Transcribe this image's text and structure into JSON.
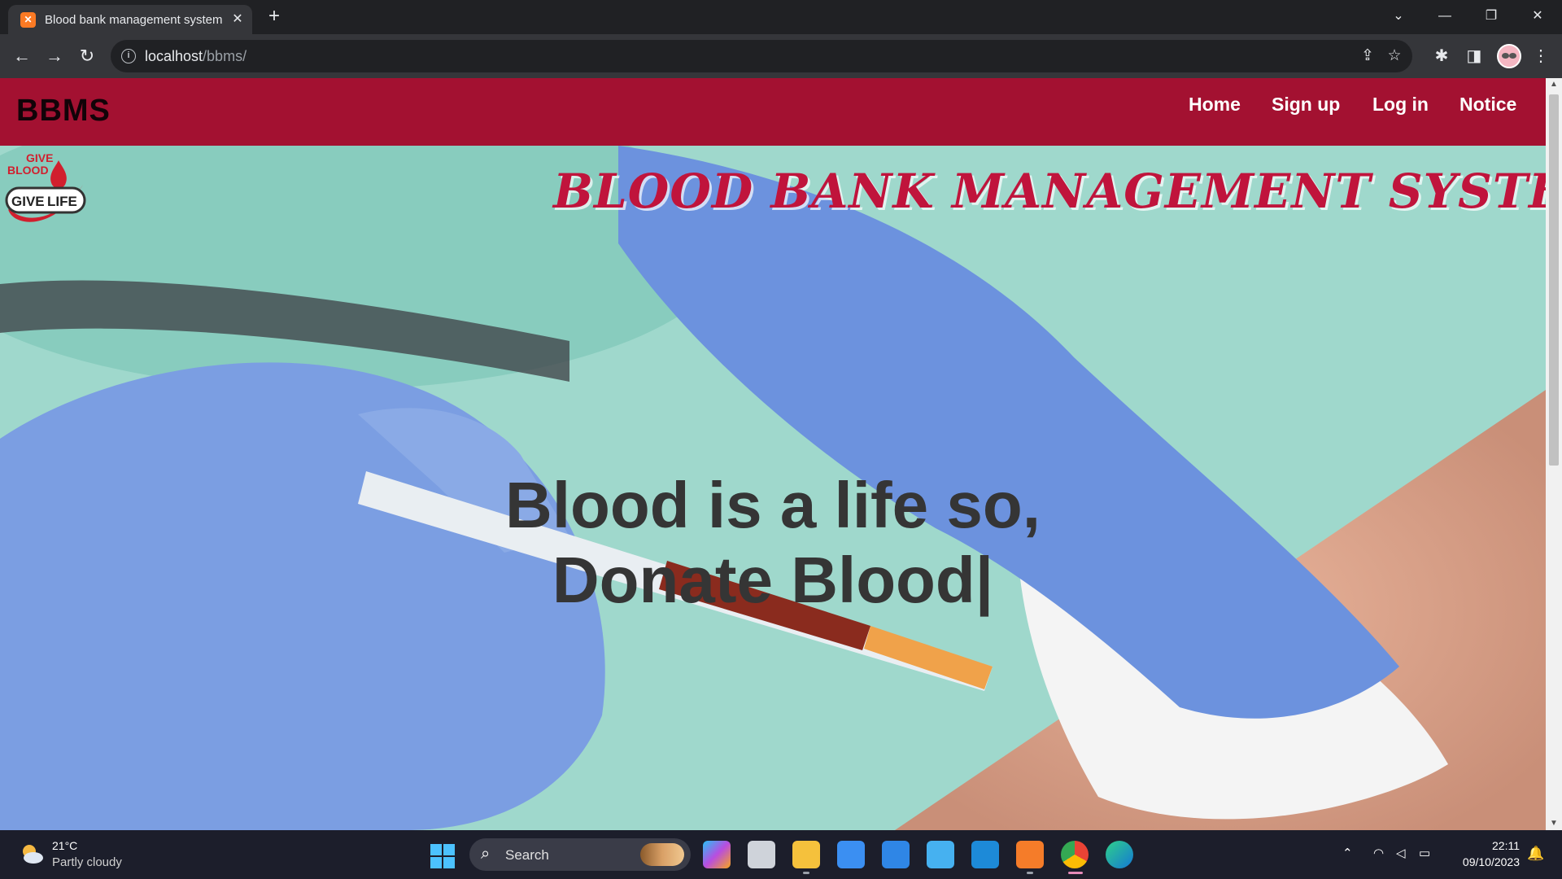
{
  "browser": {
    "tab_title": "Blood bank management system",
    "tab_favicon": "xampp-icon",
    "url_host": "localhost",
    "url_path": "/bbms/"
  },
  "site": {
    "brand": "BBMS",
    "nav": [
      "Home",
      "Sign up",
      "Log in",
      "Notice"
    ],
    "logo_lines": [
      "GIVE",
      "BLOOD",
      "GIVE",
      "LIFE"
    ],
    "hero_title": "BLOOD BANK MANAGEMENT SYSTEM",
    "tagline_line1": "Blood is a life so,",
    "tagline_line2": "Donate Blood|",
    "colors": {
      "navbar": "#a31131",
      "title": "#c0143c",
      "tagline": "#353535"
    }
  },
  "taskbar": {
    "temperature": "21°C",
    "weather": "Partly cloudy",
    "search_placeholder": "Search",
    "time": "22:11",
    "date": "09/10/2023",
    "apps": [
      "copilot-icon",
      "task-view-icon",
      "file-explorer-icon",
      "microsoft-store-icon",
      "mail-icon",
      "notepad-icon",
      "vscode-icon",
      "xampp-icon",
      "chrome-icon",
      "edge-icon"
    ]
  }
}
